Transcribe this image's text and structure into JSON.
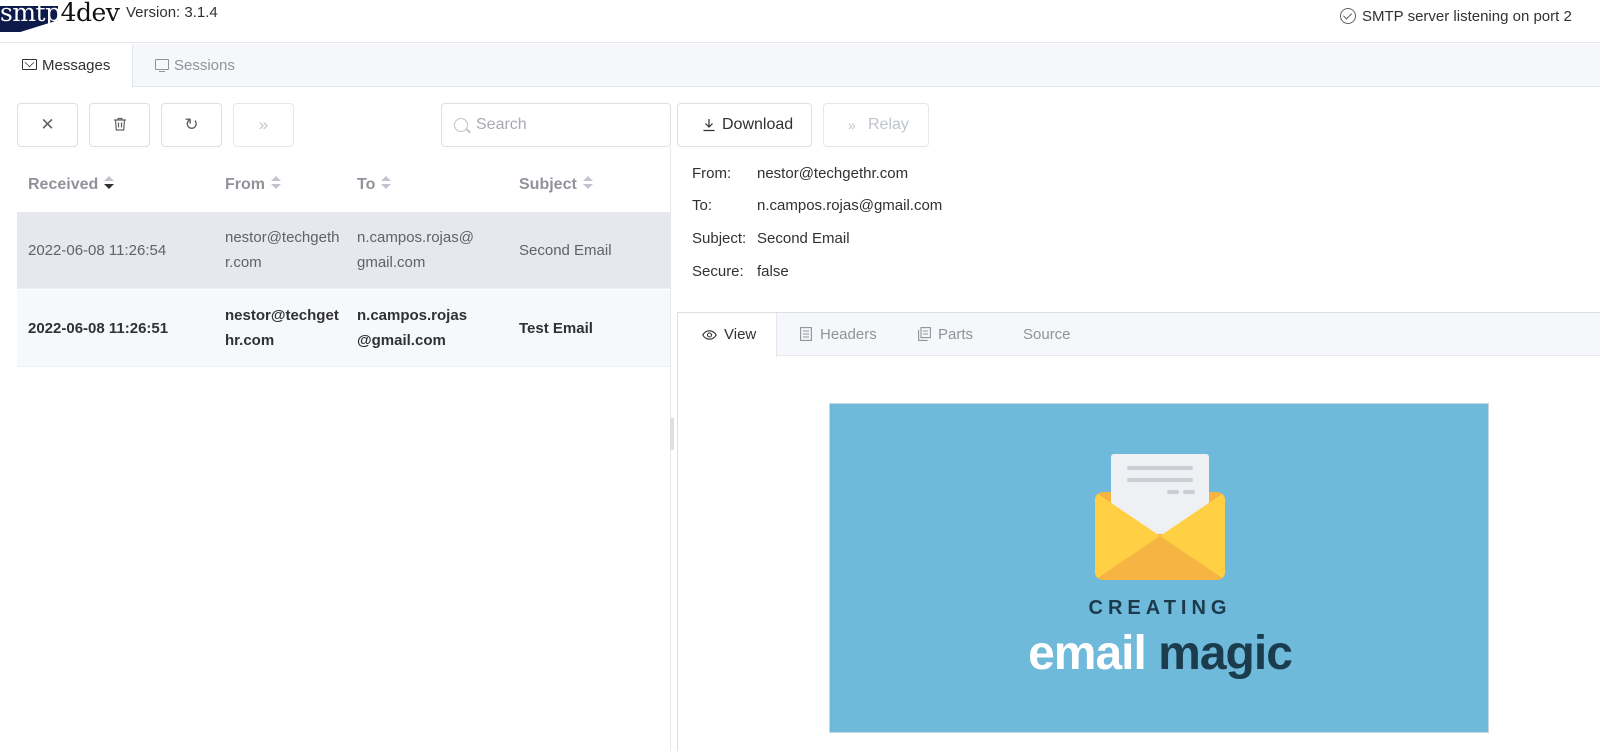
{
  "app": {
    "logo_text_a": "smtp",
    "logo_text_b": "4dev",
    "version": "Version: 3.1.4",
    "status": "SMTP server listening on port 2"
  },
  "main_tabs": [
    {
      "label": "Messages",
      "icon": "envelope-icon",
      "active": true
    },
    {
      "label": "Sessions",
      "icon": "monitor-icon",
      "active": false
    }
  ],
  "toolbar": {
    "clear_icon": "✕",
    "delete_icon": "trash-icon",
    "refresh_icon": "↻",
    "relay_icon": "»",
    "search_placeholder": "Search"
  },
  "table": {
    "columns": [
      "Received",
      "From",
      "To",
      "Subject"
    ],
    "rows": [
      {
        "received": "2022-06-08 11:26:54",
        "from": "nestor@techgethr.com",
        "to": "n.campos.rojas@gmail.com",
        "subject": "Second Email",
        "selected": true,
        "unread": false
      },
      {
        "received": "2022-06-08 11:26:51",
        "from": "nestor@techgethr.com",
        "to": "n.campos.rojas@gmail.com",
        "subject": "Test Email",
        "selected": false,
        "unread": true
      }
    ]
  },
  "message": {
    "download_label": "Download",
    "relay_label": "Relay",
    "fields": [
      {
        "label": "From:",
        "value": "nestor@techgethr.com"
      },
      {
        "label": "To:",
        "value": "n.campos.rojas@gmail.com"
      },
      {
        "label": "Subject:",
        "value": "Second Email"
      },
      {
        "label": "Secure:",
        "value": "false"
      }
    ],
    "tabs": [
      {
        "label": "View",
        "icon": "eye-icon",
        "active": true
      },
      {
        "label": "Headers",
        "icon": "document-icon",
        "active": false
      },
      {
        "label": "Parts",
        "icon": "files-icon",
        "active": false
      },
      {
        "label": "Source",
        "icon": "",
        "active": false
      }
    ],
    "banner": {
      "line1": "CREATING",
      "word1": "email",
      "word2": "magic",
      "bg_color": "#6fb9db"
    }
  }
}
